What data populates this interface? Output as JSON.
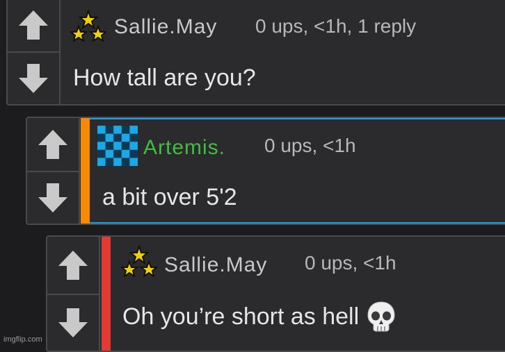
{
  "comments": [
    {
      "username": "Sallie.May",
      "meta": "0 ups, <1h, 1 reply",
      "text": "How tall are you?",
      "avatar": "three-stars-icon",
      "username_color": "#c9c9c9"
    },
    {
      "username": "Artemis.",
      "meta": "0 ups, <1h",
      "text": "a bit over 5'2",
      "avatar": "checkered-pattern-icon",
      "username_color": "#3fbf3f",
      "bar_color": "#f58a07",
      "border_color": "#1fa3e0"
    },
    {
      "username": "Sallie.May",
      "meta": "0 ups, <1h",
      "text": "Oh you’re short as hell",
      "emoji": "skull-icon",
      "avatar": "three-stars-icon",
      "username_color": "#c9c9c9",
      "bar_color": "#e43a36"
    }
  ],
  "icons": {
    "upvote": "arrow-up-icon",
    "downvote": "arrow-down-icon"
  },
  "watermark": "imgflip.com"
}
